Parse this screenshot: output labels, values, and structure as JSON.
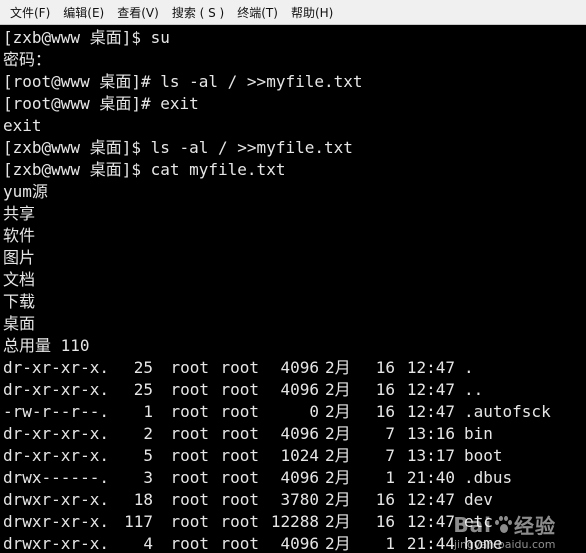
{
  "menu": [
    {
      "name": "menu-file",
      "label": "文件(F)"
    },
    {
      "name": "menu-edit",
      "label": "编辑(E)"
    },
    {
      "name": "menu-view",
      "label": "查看(V)"
    },
    {
      "name": "menu-search",
      "label": "搜索 ( S )"
    },
    {
      "name": "menu-terminal",
      "label": "终端(T)"
    },
    {
      "name": "menu-help",
      "label": "帮助(H)"
    }
  ],
  "terminal_lines": [
    "[zxb@www 桌面]$ su",
    "密码：",
    "[root@www 桌面]# ls -al / >>myfile.txt",
    "[root@www 桌面]# exit",
    "exit",
    "[zxb@www 桌面]$ ls -al / >>myfile.txt",
    "[zxb@www 桌面]$ cat myfile.txt",
    "yum源",
    "共享",
    "软件",
    "图片",
    "文档",
    "下载",
    "桌面",
    "总用量 110"
  ],
  "listing": [
    {
      "perm": "dr-xr-xr-x.",
      "links": "25",
      "owner": "root",
      "group": "root",
      "size": "4096",
      "month": "2月",
      "day": "16",
      "time": "12:47",
      "name": "."
    },
    {
      "perm": "dr-xr-xr-x.",
      "links": "25",
      "owner": "root",
      "group": "root",
      "size": "4096",
      "month": "2月",
      "day": "16",
      "time": "12:47",
      "name": ".."
    },
    {
      "perm": "-rw-r--r--.",
      "links": "1",
      "owner": "root",
      "group": "root",
      "size": "0",
      "month": "2月",
      "day": "16",
      "time": "12:47",
      "name": ".autofsck"
    },
    {
      "perm": "dr-xr-xr-x.",
      "links": "2",
      "owner": "root",
      "group": "root",
      "size": "4096",
      "month": "2月",
      "day": "7",
      "time": "13:16",
      "name": "bin"
    },
    {
      "perm": "dr-xr-xr-x.",
      "links": "5",
      "owner": "root",
      "group": "root",
      "size": "1024",
      "month": "2月",
      "day": "7",
      "time": "13:17",
      "name": "boot"
    },
    {
      "perm": "drwx------.",
      "links": "3",
      "owner": "root",
      "group": "root",
      "size": "4096",
      "month": "2月",
      "day": "1",
      "time": "21:40",
      "name": ".dbus"
    },
    {
      "perm": "drwxr-xr-x.",
      "links": "18",
      "owner": "root",
      "group": "root",
      "size": "3780",
      "month": "2月",
      "day": "16",
      "time": "12:47",
      "name": "dev"
    },
    {
      "perm": "drwxr-xr-x.",
      "links": "117",
      "owner": "root",
      "group": "root",
      "size": "12288",
      "month": "2月",
      "day": "16",
      "time": "12:47",
      "name": "etc"
    },
    {
      "perm": "drwxr-xr-x.",
      "links": "4",
      "owner": "root",
      "group": "root",
      "size": "4096",
      "month": "2月",
      "day": "1",
      "time": "21:44",
      "name": "home"
    }
  ],
  "watermark": {
    "logo_left": "Bai",
    "logo_right": "经验",
    "url": "jingyan.baidu.com"
  },
  "colors": {
    "terminal_bg": "#000000",
    "terminal_fg": "#e6e6e6",
    "menubar_bg": "#f0f0f0"
  }
}
